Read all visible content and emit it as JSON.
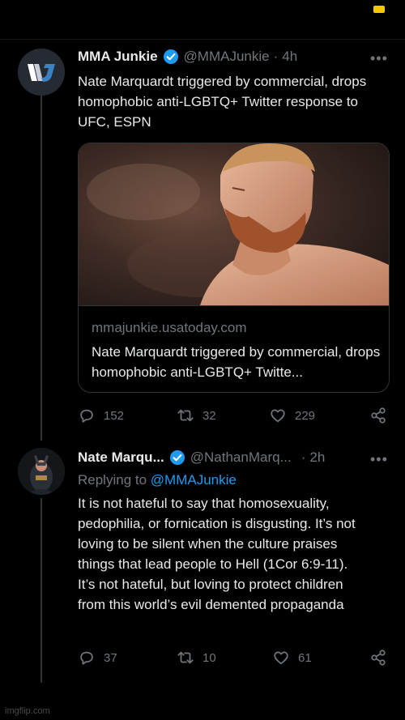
{
  "tweet1": {
    "name": "MMA Junkie",
    "handle": "@MMAJunkie",
    "time": "4h",
    "text": "Nate Marquardt triggered by commercial, drops homophobic anti-LGBTQ+ Twitter response to UFC, ESPN",
    "card": {
      "domain": "mmajunkie.usatoday.com",
      "title": "Nate Marquardt triggered by commercial, drops homophobic anti-LGBTQ+ Twitte..."
    },
    "actions": {
      "replies": "152",
      "retweets": "32",
      "likes": "229"
    }
  },
  "tweet2": {
    "name": "Nate Marqu...",
    "handle": "@NathanMarq...",
    "time": "2h",
    "replying_prefix": "Replying to",
    "replying_to": "@MMAJunkie",
    "text": "It is not hateful to say that homosexuality, pedophilia, or fornication is disgusting. It’s not loving to be silent when the culture praises things that lead people to Hell (1Cor 6:9-11). It’s not hateful, but loving to protect children from this world’s evil demented propaganda",
    "actions": {
      "replies": "37",
      "retweets": "10",
      "likes": "61"
    }
  },
  "separator": "·",
  "more": "•••",
  "watermark": "imgflip.com",
  "colors": {
    "background": "#000000",
    "text": "#e7e9ea",
    "muted": "#71767b",
    "link": "#1d9bf0",
    "verified": "#1d9bf0",
    "status_pill": "#f5c800"
  },
  "icons": [
    "verified-badge-icon",
    "reply-icon",
    "retweet-icon",
    "like-icon",
    "share-icon",
    "more-icon"
  ]
}
